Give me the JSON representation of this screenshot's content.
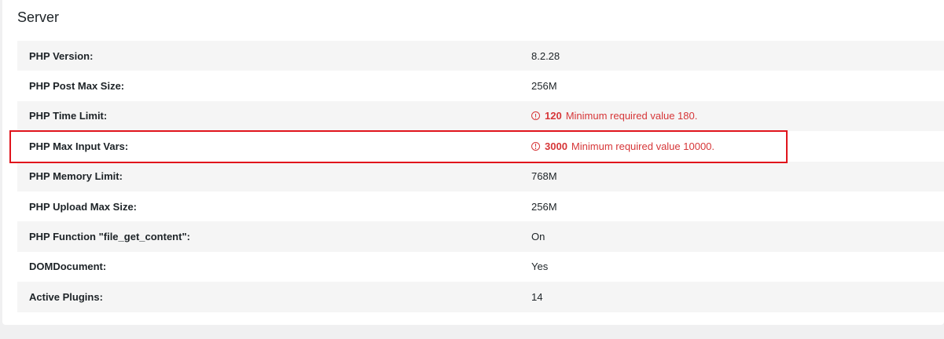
{
  "section": {
    "title": "Server"
  },
  "rows": [
    {
      "label": "PHP Version:",
      "value": "8.2.28"
    },
    {
      "label": "PHP Post Max Size:",
      "value": "256M"
    },
    {
      "label": "PHP Time Limit:",
      "warn_value": "120",
      "warn_message": "Minimum required value 180."
    },
    {
      "label": "PHP Max Input Vars:",
      "warn_value": "3000",
      "warn_message": "Minimum required value 10000."
    },
    {
      "label": "PHP Memory Limit:",
      "value": "768M"
    },
    {
      "label": "PHP Upload Max Size:",
      "value": "256M"
    },
    {
      "label": "PHP Function \"file_get_content\":",
      "value": "On"
    },
    {
      "label": "DOMDocument:",
      "value": "Yes"
    },
    {
      "label": "Active Plugins:",
      "value": "14"
    }
  ],
  "icons": {
    "warning": "warning-circle-icon"
  },
  "colors": {
    "warning": "#d63638",
    "highlight": "#e0141c",
    "row_alt": "#f5f5f5"
  }
}
